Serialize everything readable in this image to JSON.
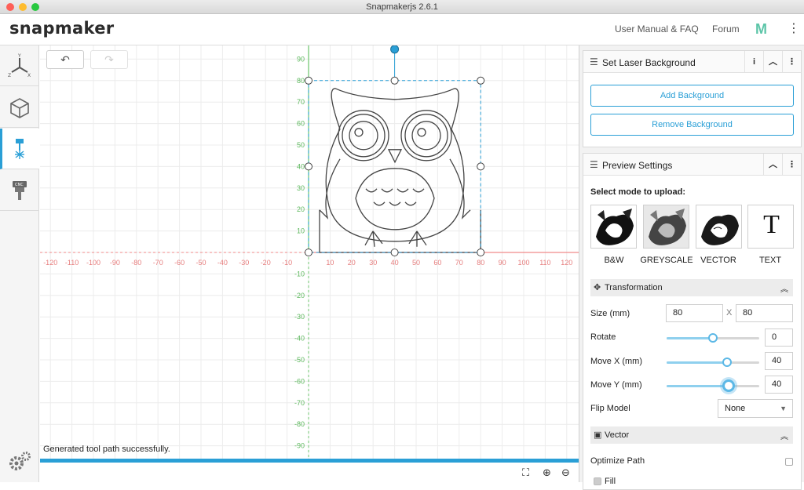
{
  "window": {
    "title": "Snapmakerjs 2.6.1"
  },
  "header": {
    "logo": "snapmaker",
    "links": [
      "User Manual & FAQ",
      "Forum"
    ],
    "brand_mark": "M",
    "more_icon": "kebab-icon"
  },
  "leftbar": {
    "items": [
      {
        "name": "axes-view",
        "icon": "axes-icon"
      },
      {
        "name": "3d-print",
        "icon": "cube-icon"
      },
      {
        "name": "laser",
        "icon": "laser-icon",
        "active": true
      },
      {
        "name": "cnc",
        "icon": "cnc-icon"
      }
    ],
    "settings_icon": "gear-icon"
  },
  "canvas": {
    "undo_icon": "undo-icon",
    "redo_icon": "redo-icon",
    "x_ticks": [
      "-120",
      "-110",
      "-100",
      "-90",
      "-80",
      "-70",
      "-60",
      "-50",
      "-40",
      "-30",
      "-20",
      "-10",
      "10",
      "20",
      "30",
      "40",
      "50",
      "60",
      "70",
      "80",
      "90",
      "100",
      "110",
      "120"
    ],
    "y_ticks_pos": [
      "90",
      "80",
      "70",
      "60",
      "50",
      "40",
      "30",
      "20",
      "10"
    ],
    "y_ticks_neg": [
      "-10",
      "-20",
      "-30",
      "-40",
      "-50",
      "-60",
      "-70",
      "-80",
      "-90"
    ],
    "axis_color_x": "#f08a8a",
    "axis_color_y": "#6cc46c",
    "selection_color": "#2a9fd6",
    "status_message": "Generated tool path successfully.",
    "bottom_icons": [
      "fit-view-icon",
      "zoom-in-icon",
      "zoom-out-icon"
    ]
  },
  "laser_background": {
    "title": "Set Laser Background",
    "info_icon": "i",
    "collapse_icon": "⌃",
    "add_label": "Add Background",
    "remove_label": "Remove Background"
  },
  "preview": {
    "title": "Preview Settings",
    "mode_prompt": "Select mode to upload:",
    "modes": [
      {
        "label": "B&W"
      },
      {
        "label": "GREYSCALE"
      },
      {
        "label": "VECTOR"
      },
      {
        "label": "TEXT",
        "glyph": "T"
      }
    ],
    "transformation": {
      "title": "Transformation",
      "size_label": "Size (mm)",
      "size_w": "80",
      "size_sep": "X",
      "size_h": "80",
      "rotate_label": "Rotate",
      "rotate_value": "0",
      "rotate_slider_pct": 0.5,
      "move_x_label": "Move X (mm)",
      "move_x_value": "40",
      "move_x_slider_pct": 0.65,
      "move_y_label": "Move Y (mm)",
      "move_y_value": "40",
      "move_y_slider_pct": 0.67,
      "flip_label": "Flip Model",
      "flip_value": "None"
    },
    "vector": {
      "title": "Vector",
      "optimize_label": "Optimize Path",
      "fill_label": "Fill"
    }
  }
}
